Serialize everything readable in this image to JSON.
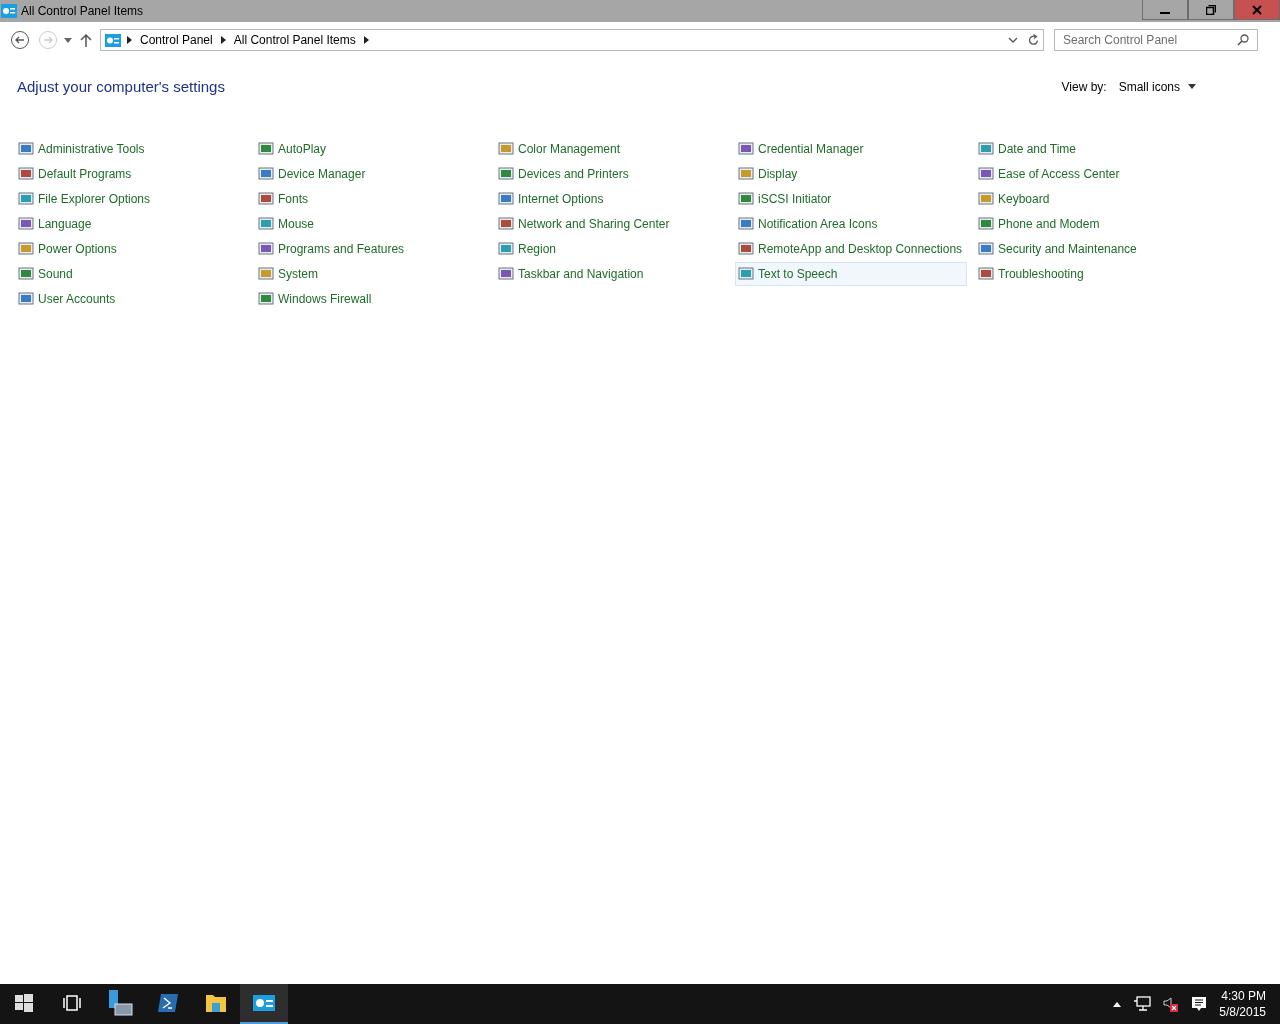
{
  "window": {
    "title": "All Control Panel Items"
  },
  "address_bar": {
    "breadcrumbs": [
      "Control Panel",
      "All Control Panel Items"
    ]
  },
  "search": {
    "placeholder": "Search Control Panel"
  },
  "heading": "Adjust your computer's settings",
  "view_by": {
    "label": "View by:",
    "value": "Small icons"
  },
  "items": [
    {
      "label": "Administrative Tools",
      "hovered": false
    },
    {
      "label": "AutoPlay",
      "hovered": false
    },
    {
      "label": "Color Management",
      "hovered": false
    },
    {
      "label": "Credential Manager",
      "hovered": false
    },
    {
      "label": "Date and Time",
      "hovered": false
    },
    {
      "label": "Default Programs",
      "hovered": false
    },
    {
      "label": "Device Manager",
      "hovered": false
    },
    {
      "label": "Devices and Printers",
      "hovered": false
    },
    {
      "label": "Display",
      "hovered": false
    },
    {
      "label": "Ease of Access Center",
      "hovered": false
    },
    {
      "label": "File Explorer Options",
      "hovered": false
    },
    {
      "label": "Fonts",
      "hovered": false
    },
    {
      "label": "Internet Options",
      "hovered": false
    },
    {
      "label": "iSCSI Initiator",
      "hovered": false
    },
    {
      "label": "Keyboard",
      "hovered": false
    },
    {
      "label": "Language",
      "hovered": false
    },
    {
      "label": "Mouse",
      "hovered": false
    },
    {
      "label": "Network and Sharing Center",
      "hovered": false
    },
    {
      "label": "Notification Area Icons",
      "hovered": false
    },
    {
      "label": "Phone and Modem",
      "hovered": false
    },
    {
      "label": "Power Options",
      "hovered": false
    },
    {
      "label": "Programs and Features",
      "hovered": false
    },
    {
      "label": "Region",
      "hovered": false
    },
    {
      "label": "RemoteApp and Desktop Connections",
      "hovered": false
    },
    {
      "label": "Security and Maintenance",
      "hovered": false
    },
    {
      "label": "Sound",
      "hovered": false
    },
    {
      "label": "System",
      "hovered": false
    },
    {
      "label": "Taskbar and Navigation",
      "hovered": false
    },
    {
      "label": "Text to Speech",
      "hovered": true
    },
    {
      "label": "Troubleshooting",
      "hovered": false
    },
    {
      "label": "User Accounts",
      "hovered": false
    },
    {
      "label": "Windows Firewall",
      "hovered": false
    }
  ],
  "taskbar": {
    "apps": [
      {
        "kind": "start",
        "selected": false
      },
      {
        "kind": "taskview",
        "selected": false
      },
      {
        "kind": "server",
        "selected": false
      },
      {
        "kind": "shell",
        "selected": false
      },
      {
        "kind": "folder",
        "selected": false
      },
      {
        "kind": "controlpanel",
        "selected": true
      }
    ],
    "time": "4:30 PM",
    "date": "5/8/2015"
  }
}
